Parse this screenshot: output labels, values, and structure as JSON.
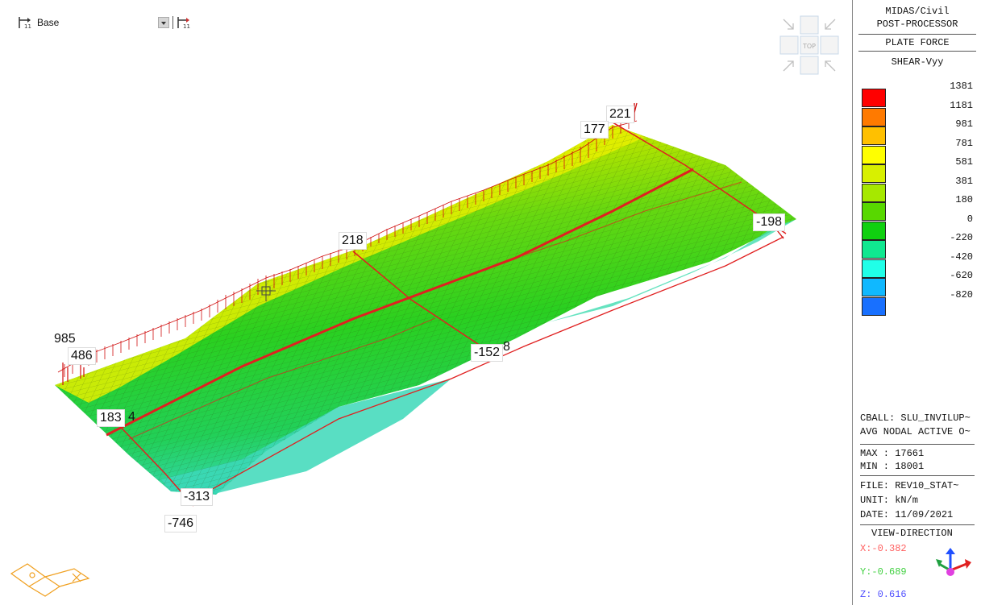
{
  "toolbar": {
    "stage_label": "Base"
  },
  "nav_cube": {
    "top_label": "TOP"
  },
  "labels": {
    "l221": "221",
    "l177": "177",
    "l218": "218",
    "l198": "-198",
    "l985": "985",
    "l486": "486",
    "l183": "183",
    "l4": "4",
    "l152": "-152",
    "l8": "8",
    "l313": "-313",
    "l746": "-746"
  },
  "legend": {
    "title_line1": "MIDAS/Civil",
    "title_line2": "POST-PROCESSOR",
    "result_type": "PLATE FORCE",
    "component": "SHEAR-Vyy",
    "scale_values": [
      "1381",
      "1181",
      "981",
      "781",
      "581",
      "381",
      "180",
      "0",
      "-220",
      "-420",
      "-620",
      "-820"
    ],
    "scale_colors": [
      "#ff0000",
      "#ff7a00",
      "#ffc000",
      "#ffff00",
      "#d8f000",
      "#a6e800",
      "#58d800",
      "#10d010",
      "#10e890",
      "#20ffe8",
      "#10b8ff",
      "#1870ff"
    ],
    "cball": "CBALL: SLU_INVILUP~",
    "avg": "AVG NODAL ACTIVE O~",
    "max": "MAX : 17661",
    "min": "MIN : 18001",
    "file": "FILE: REV10_STAT~",
    "unit": "UNIT: kN/m",
    "date": "DATE: 11/09/2021",
    "view_direction": "VIEW-DIRECTION",
    "vx": "X:-0.382",
    "vy": "Y:-0.689",
    "vz": "Z: 0.616",
    "vx_color": "#ff6060",
    "vy_color": "#40d040",
    "vz_color": "#5050ff"
  }
}
